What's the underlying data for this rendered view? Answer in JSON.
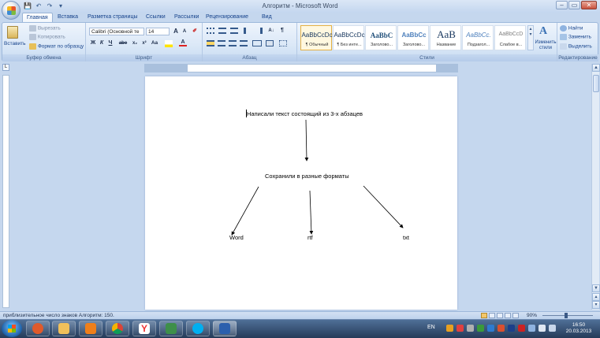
{
  "app": {
    "title": "Алгоритм - Microsoft Word",
    "qat": [
      "💾",
      "↶",
      "↷",
      "▾"
    ],
    "window_buttons": [
      "–",
      "▭",
      "✕"
    ]
  },
  "tabs": [
    "Главная",
    "Вставка",
    "Разметка страницы",
    "Ссылки",
    "Рассылки",
    "Рецензирование",
    "Вид"
  ],
  "ribbon": {
    "clipboard": {
      "paste": "Вставить",
      "cut": "Вырезать",
      "copy": "Копировать",
      "format_painter": "Формат по образцу",
      "label": "Буфер обмена"
    },
    "font": {
      "font_name": "Calibri (Основной те",
      "font_size": "14",
      "label": "Шрифт",
      "buttons": [
        "Ж",
        "К",
        "Ч",
        "abe",
        "x₂",
        "x²",
        "Aa",
        "A"
      ]
    },
    "paragraph": {
      "label": "Абзац"
    },
    "styles": {
      "label": "Стили",
      "items": [
        {
          "sample": "AaBbCcDc",
          "name": "¶ Обычный"
        },
        {
          "sample": "AaBbCcDc",
          "name": "¶ Без инте..."
        },
        {
          "sample": "AaBbC",
          "name": "Заголово..."
        },
        {
          "sample": "AaBbCc",
          "name": "Заголово..."
        },
        {
          "sample": "AaB",
          "name": "Название"
        },
        {
          "sample": "AaBbCc.",
          "name": "Подзагол..."
        },
        {
          "sample": "AaBbCcD",
          "name": "Слабое в..."
        }
      ],
      "change_styles": "Изменить стили"
    },
    "editing": {
      "label": "Редактирование",
      "find": "Найти",
      "replace": "Заменить",
      "select": "Выделить"
    }
  },
  "document": {
    "paragraph1": "Написали текст состоящий из 3-х абзацев",
    "paragraph2": "Сохранили в разные форматы",
    "format_word": "Word",
    "format_rtf": "rtf",
    "format_txt": "txt"
  },
  "statusbar": {
    "text": "приблизительное число знаков Алгоритм: 150.",
    "zoom": "90%"
  },
  "taskbar": {
    "lang": "EN",
    "time": "16:50",
    "date": "20.03.2013"
  }
}
